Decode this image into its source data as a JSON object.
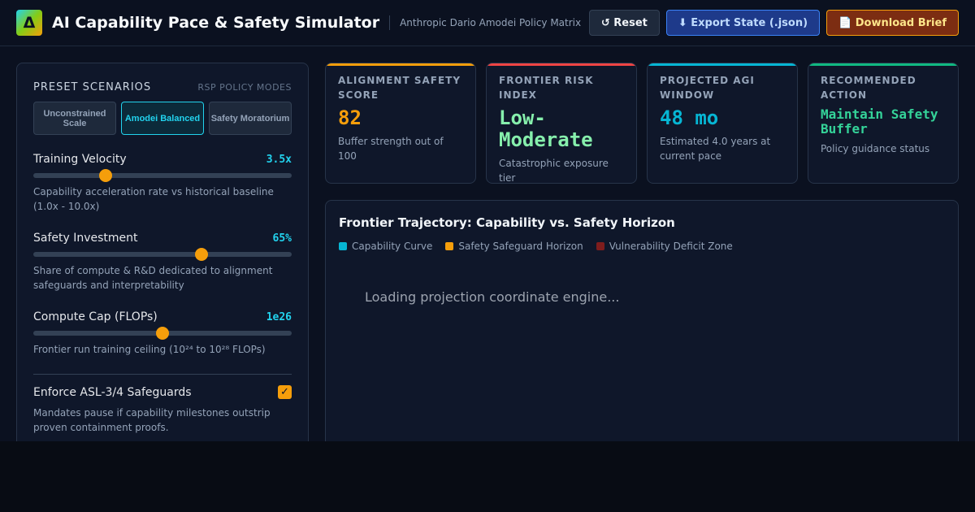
{
  "header": {
    "logo_glyph": "Δ",
    "title": "AI Capability Pace & Safety Simulator",
    "subtitle": "Anthropic Dario Amodei Policy Matrix",
    "buttons": {
      "reset": "↺ Reset",
      "export": "⬇ Export State (.json)",
      "brief": "📄 Download Brief"
    }
  },
  "controls": {
    "preset_title": "Preset Scenarios",
    "preset_mode": "RSP Policy Modes",
    "presets": [
      {
        "label": "Unconstrained Scale",
        "active": false
      },
      {
        "label": "Amodei Balanced",
        "active": true
      },
      {
        "label": "Safety Moratorium",
        "active": false
      }
    ],
    "sliders": [
      {
        "label": "Training Velocity",
        "value": "3.5x",
        "level": 0.28,
        "desc": "Capability acceleration rate vs historical baseline (1.0x - 10.0x)"
      },
      {
        "label": "Safety Investment",
        "value": "65%",
        "level": 0.65,
        "desc": "Share of compute & R&D dedicated to alignment safeguards and interpretability"
      },
      {
        "label": "Compute Cap (FLOPs)",
        "value": "1e26",
        "level": 0.5,
        "desc": "Frontier run training ceiling (10²⁴ to 10²⁸ FLOPs)"
      }
    ],
    "toggle": {
      "label": "Enforce ASL-3/4 Safeguards",
      "checked": true,
      "check_glyph": "✓",
      "desc": "Mandates pause if capability milestones outstrip proven containment proofs."
    }
  },
  "metrics": [
    {
      "label": "Alignment Safety Score",
      "value": "82",
      "desc": "Buffer strength out of 100",
      "accent": "#f59e0b",
      "value_color": "#f59e0b",
      "value_size": 24
    },
    {
      "label": "Frontier Risk Index",
      "value": "Low-Moderate",
      "desc": "Catastrophic exposure tier",
      "accent": "#ef4444",
      "value_color": "#86efac",
      "value_size": 24
    },
    {
      "label": "Projected AGI Window",
      "value": "48 mo",
      "desc": "Estimated 4.0 years at current pace",
      "accent": "#06b6d4",
      "value_color": "#06b6d4",
      "value_size": 24
    },
    {
      "label": "Recommended Action",
      "value": "Maintain Safety Buffer",
      "desc": "Policy guidance status",
      "accent": "#10b981",
      "value_color": "#34d399",
      "value_size": 16
    }
  ],
  "trajectory": {
    "title": "Frontier Trajectory: Capability vs. Safety Horizon",
    "legend": [
      {
        "label": "Capability Curve",
        "color": "#06b6d4"
      },
      {
        "label": "Safety Safeguard Horizon",
        "color": "#f59e0b"
      },
      {
        "label": "Vulnerability Deficit Zone",
        "color": "#7f1d1d"
      }
    ],
    "loading": "Loading projection coordinate engine..."
  }
}
